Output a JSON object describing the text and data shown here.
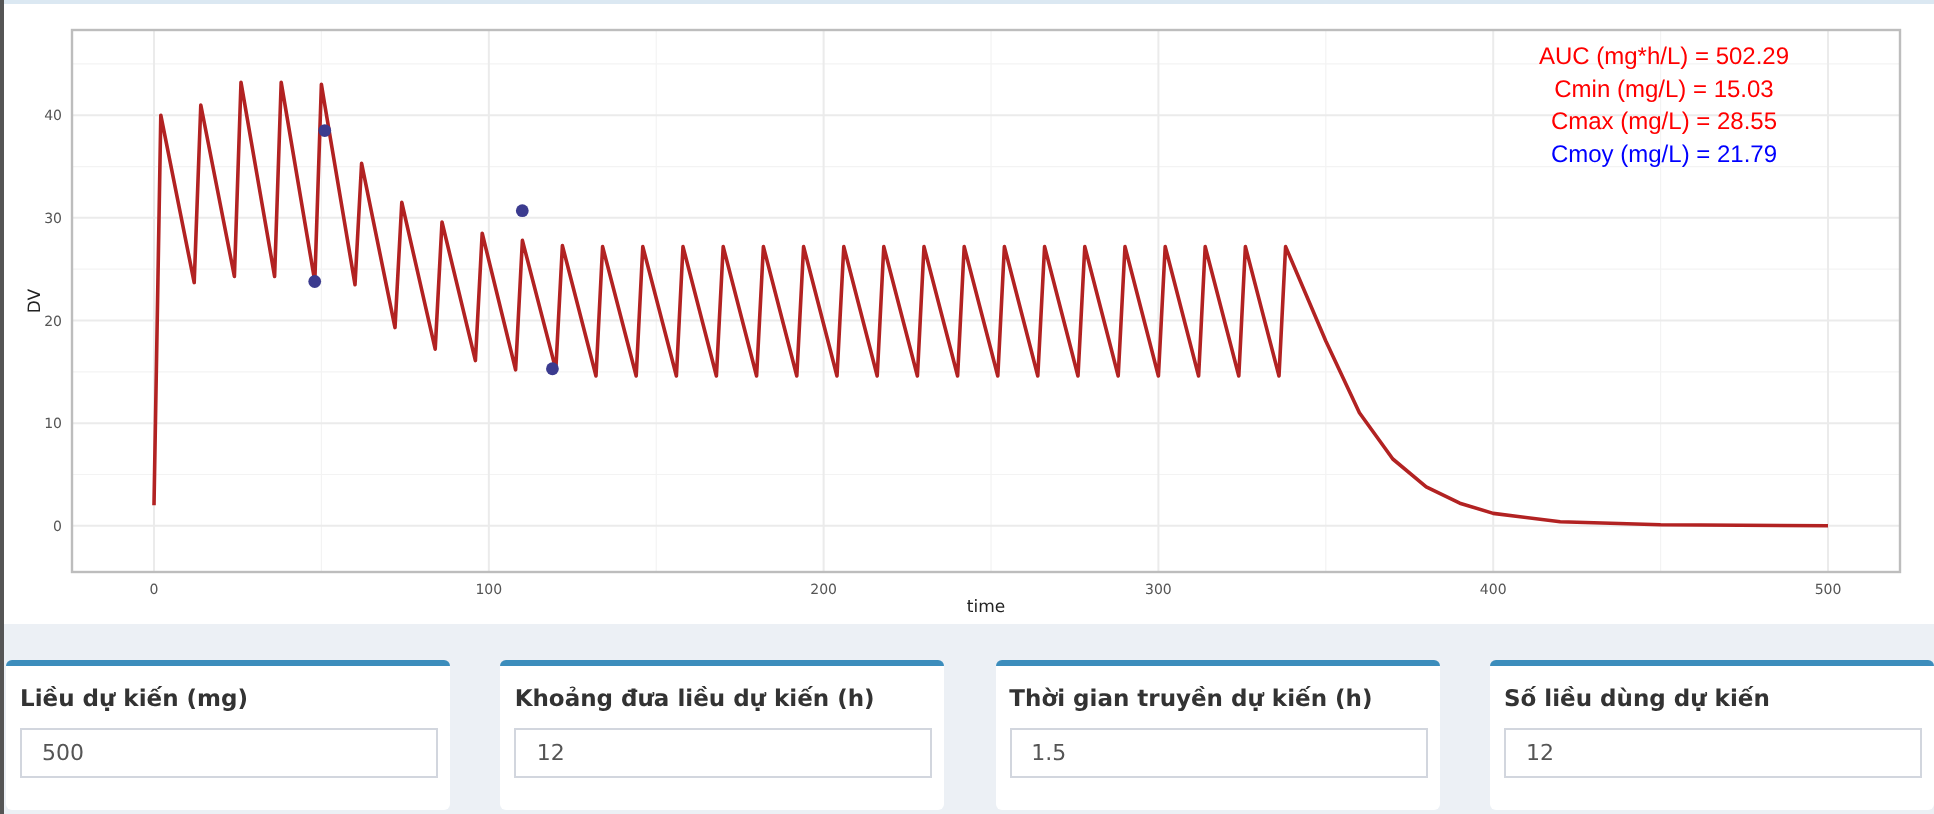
{
  "chart": {
    "chart_data": {
      "type": "line",
      "xlabel": "time",
      "ylabel": "DV",
      "grid": true,
      "x": [
        0,
        2,
        12,
        14,
        24,
        26,
        36,
        38,
        48,
        50,
        51,
        60,
        62,
        72,
        74,
        84,
        86,
        96,
        98,
        108,
        110,
        119,
        120,
        122,
        132,
        134,
        144,
        146,
        156,
        158,
        168,
        170,
        180,
        182,
        192,
        194,
        204,
        206,
        216,
        218,
        228,
        230,
        240,
        242,
        252,
        254,
        264,
        266,
        276,
        278,
        288,
        290,
        300,
        302,
        312,
        314,
        324,
        326,
        336,
        338,
        350,
        360,
        370,
        380,
        390,
        400,
        420,
        450,
        500
      ],
      "series": [
        {
          "color": "#b22222",
          "values": [
            2,
            40,
            23.7,
            41,
            24.3,
            43.2,
            24.3,
            43.2,
            23.8,
            43,
            41,
            23.5,
            35.3,
            19.3,
            31.5,
            17.2,
            29.6,
            16.1,
            28.5,
            15.2,
            27.8,
            16.5,
            15.2,
            27.3,
            14.6,
            27.2,
            14.6,
            27.2,
            14.6,
            27.2,
            14.6,
            27.2,
            14.6,
            27.2,
            14.6,
            27.2,
            14.6,
            27.2,
            14.6,
            27.2,
            14.6,
            27.2,
            14.6,
            27.2,
            14.6,
            27.2,
            14.6,
            27.2,
            14.6,
            27.2,
            14.6,
            27.2,
            14.6,
            27.2,
            14.6,
            27.2,
            14.6,
            27.2,
            14.6,
            27.2,
            18,
            11,
            6.5,
            3.8,
            2.2,
            1.2,
            0.4,
            0.1,
            0
          ]
        },
        {
          "type": "scatter",
          "color": "#3b3b8f",
          "values": [
            null,
            null,
            null,
            null,
            null,
            null,
            null,
            null,
            23.8,
            null,
            38.5,
            null,
            null,
            null,
            null,
            null,
            null,
            null,
            null,
            null,
            30.7,
            15.3,
            null,
            null,
            null,
            null,
            null,
            null,
            null,
            null,
            null,
            null,
            null,
            null,
            null,
            null,
            null,
            null,
            null,
            null,
            null,
            null,
            null,
            null,
            null,
            null,
            null,
            null,
            null,
            null,
            null,
            null,
            null,
            null,
            null,
            null,
            null,
            null,
            null,
            null,
            null,
            null,
            null,
            null,
            null,
            null,
            null,
            null,
            null
          ]
        }
      ],
      "xlim": [
        -24.5,
        521.5
      ],
      "ylim": [
        -4.5,
        48.3
      ],
      "xticks": [
        0,
        100,
        200,
        300,
        400,
        500
      ],
      "yticks": [
        0,
        10,
        20,
        30,
        40
      ]
    },
    "stats": [
      {
        "text": "AUC (mg*h/L) = 502.29",
        "color": "#ff0000"
      },
      {
        "text": "Cmin (mg/L) = 15.03",
        "color": "#ff0000"
      },
      {
        "text": "Cmax (mg/L) = 28.55",
        "color": "#ff0000"
      },
      {
        "text": "Cmoy (mg/L) = 21.79",
        "color": "#0000ff"
      }
    ]
  },
  "inputs": [
    {
      "label": "Liều dự kiến (mg)",
      "value": "500"
    },
    {
      "label": "Khoảng đưa liều dự kiến (h)",
      "value": "12"
    },
    {
      "label": "Thời gian truyền dự kiến (h)",
      "value": "1.5"
    },
    {
      "label": "Số liều dùng dự kiến",
      "value": "12"
    }
  ]
}
